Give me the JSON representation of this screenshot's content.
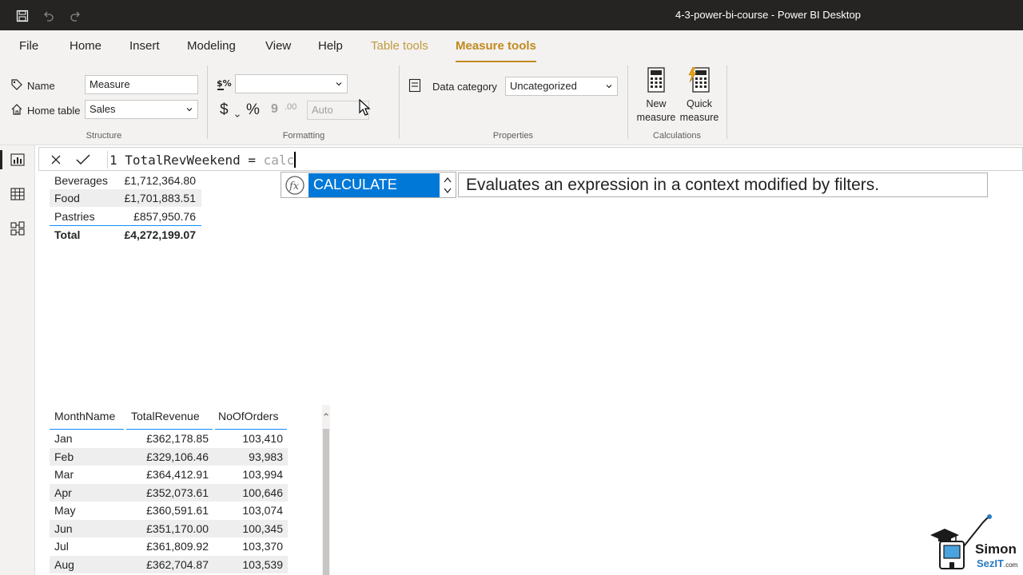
{
  "window": {
    "title": "4-3-power-bi-course - Power BI Desktop"
  },
  "menu": {
    "tabs": [
      {
        "label": "File"
      },
      {
        "label": "Home"
      },
      {
        "label": "Insert"
      },
      {
        "label": "Modeling"
      },
      {
        "label": "View"
      },
      {
        "label": "Help"
      },
      {
        "label": "Table tools"
      },
      {
        "label": "Measure tools"
      }
    ],
    "active": "Measure tools"
  },
  "ribbon": {
    "structure": {
      "group_label": "Structure",
      "name_label": "Name",
      "name_value": "Measure",
      "home_table_label": "Home table",
      "home_table_value": "Sales"
    },
    "formatting": {
      "group_label": "Formatting",
      "format_value": "",
      "currency_symbol": "$",
      "percent_symbol": "%",
      "comma_symbol": "9",
      "decimal_symbol": ".00",
      "decimal_places_placeholder": "Auto"
    },
    "properties": {
      "group_label": "Properties",
      "data_category_label": "Data category",
      "data_category_value": "Uncategorized"
    },
    "calculations": {
      "group_label": "Calculations",
      "new_measure_line1": "New",
      "new_measure_line2": "measure",
      "quick_measure_line1": "Quick",
      "quick_measure_line2": "measure"
    }
  },
  "formula_bar": {
    "line_number": "1",
    "expression": "TotalRevWeekend = ",
    "typed": "calc"
  },
  "autocomplete": {
    "selected": "CALCULATE",
    "description": "Evaluates an expression in a context modified by filters."
  },
  "category_table": {
    "rows": [
      {
        "category": "Beverages",
        "value": "£1,712,364.80"
      },
      {
        "category": "Food",
        "value": "£1,701,883.51"
      },
      {
        "category": "Pastries",
        "value": "£857,950.76"
      }
    ],
    "total_label": "Total",
    "total_value": "£4,272,199.07"
  },
  "month_table": {
    "headers": [
      "MonthName",
      "TotalRevenue",
      "NoOfOrders"
    ],
    "rows": [
      [
        "Jan",
        "£362,178.85",
        "103,410"
      ],
      [
        "Feb",
        "£329,106.46",
        "93,983"
      ],
      [
        "Mar",
        "£364,412.91",
        "103,994"
      ],
      [
        "Apr",
        "£352,073.61",
        "100,646"
      ],
      [
        "May",
        "£360,591.61",
        "103,074"
      ],
      [
        "Jun",
        "£351,170.00",
        "100,345"
      ],
      [
        "Jul",
        "£361,809.92",
        "103,370"
      ],
      [
        "Aug",
        "£362,704.87",
        "103,539"
      ]
    ]
  },
  "watermark": {
    "line1": "Simon",
    "line2": "SezIT",
    "suffix": ".com"
  },
  "colors": {
    "accent": "#c08a1e",
    "selection": "#0078d7",
    "header_line": "#118dff"
  }
}
